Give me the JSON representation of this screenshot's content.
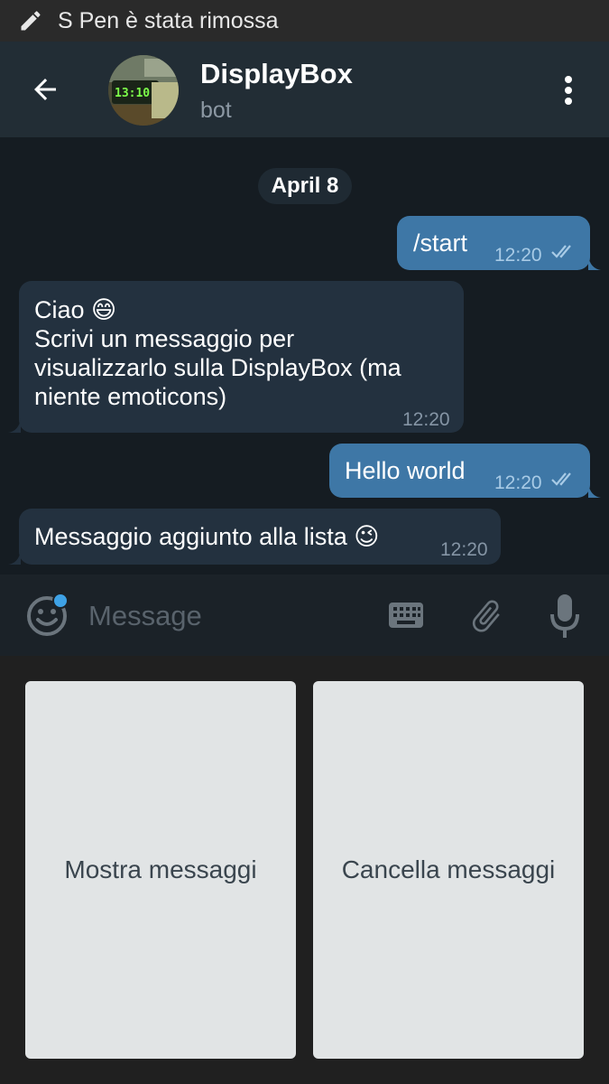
{
  "status_bar": {
    "text": "S Pen è stata rimossa",
    "icon": "pen-icon"
  },
  "header": {
    "title": "DisplayBox",
    "subtitle": "bot",
    "avatar_text": "13:10",
    "back_icon": "back-arrow-icon",
    "menu_icon": "more-vert-icon"
  },
  "chat": {
    "date": "April 8",
    "messages": [
      {
        "direction": "out",
        "text": "/start",
        "time": "12:20",
        "read": true
      },
      {
        "direction": "in",
        "lines": [
          "Ciao 😄",
          "Scrivi un messaggio per",
          "visualizzarlo sulla DisplayBox (ma",
          "niente emoticons)"
        ],
        "time": "12:20"
      },
      {
        "direction": "out",
        "text": "Hello world",
        "time": "12:20",
        "read": true
      },
      {
        "direction": "in",
        "text": "Messaggio aggiunto alla lista 😉",
        "time": "12:20"
      }
    ]
  },
  "input": {
    "placeholder": "Message",
    "value": ""
  },
  "keyboard": {
    "buttons": [
      {
        "label": "Mostra messaggi"
      },
      {
        "label": "Cancella messaggi"
      }
    ]
  },
  "colors": {
    "accent": "#3ea2e6",
    "outgoing_bubble": "#3e77a6",
    "incoming_bubble": "#23313f",
    "header": "#222d35",
    "background": "#151c22"
  }
}
